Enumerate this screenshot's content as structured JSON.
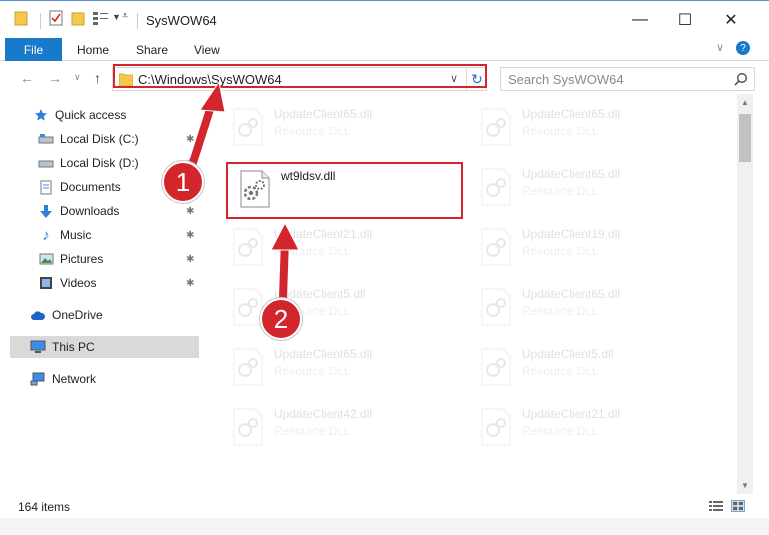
{
  "window": {
    "title": "SysWOW64",
    "minimize": "—",
    "maximize": "☐",
    "close": "✕"
  },
  "ribbon": {
    "tabs": [
      "File",
      "Home",
      "Share",
      "View"
    ],
    "expand": "∨",
    "help": "?"
  },
  "address": {
    "path": "C:\\Windows\\SysWOW64",
    "dropdown": "∨",
    "refresh": "↻"
  },
  "search": {
    "placeholder": "Search SysWOW64"
  },
  "nav": {
    "back": "←",
    "forward": "→",
    "recent": "∨",
    "up": "↑",
    "items": [
      {
        "label": "Quick access",
        "icon": "star-icon",
        "pinned": false
      },
      {
        "label": "Local Disk (C:)",
        "icon": "drive-icon",
        "pinned": true
      },
      {
        "label": "Local Disk (D:)",
        "icon": "drive-icon",
        "pinned": true
      },
      {
        "label": "Documents",
        "icon": "documents-icon",
        "pinned": true
      },
      {
        "label": "Downloads",
        "icon": "download-icon",
        "pinned": true
      },
      {
        "label": "Music",
        "icon": "music-icon",
        "pinned": true
      },
      {
        "label": "Pictures",
        "icon": "pictures-icon",
        "pinned": true
      },
      {
        "label": "Videos",
        "icon": "videos-icon",
        "pinned": true
      },
      {
        "label": "OneDrive",
        "icon": "cloud-icon",
        "pinned": false
      },
      {
        "label": "This PC",
        "icon": "computer-icon",
        "pinned": false,
        "selected": true
      },
      {
        "label": "Network",
        "icon": "network-icon",
        "pinned": false
      }
    ]
  },
  "files": {
    "col1": [
      {
        "name": "UpdateClient65.dll",
        "type": "Resource DLL",
        "faded": true
      },
      {
        "name": "wt9ldsv.dll",
        "type": "",
        "faded": false,
        "highlight": true
      },
      {
        "name": "UpdateClient21.dll",
        "type": "Resource DLL",
        "faded": true
      },
      {
        "name": "UpdateClient5.dll",
        "type": "Resource DLL",
        "faded": true
      },
      {
        "name": "UpdateClient65.dll",
        "type": "Resource DLL",
        "faded": true
      },
      {
        "name": "UpdateClient42.dll",
        "type": "Resource DLL",
        "faded": true
      }
    ],
    "col2": [
      {
        "name": "UpdateClient65.dll",
        "type": "Resource DLL",
        "faded": true
      },
      {
        "name": "UpdateClient65.dll",
        "type": "Resource DLL",
        "faded": true
      },
      {
        "name": "UpdateClient19.dll",
        "type": "Resource DLL",
        "faded": true
      },
      {
        "name": "UpdateClient65.dll",
        "type": "Resource DLL",
        "faded": true
      },
      {
        "name": "UpdateClient5.dll",
        "type": "Resource DLL",
        "faded": true
      },
      {
        "name": "UpdateClient21.dll",
        "type": "Resource DLL",
        "faded": true
      }
    ]
  },
  "status": {
    "item_count": "164 items"
  },
  "annotations": {
    "step1": "1",
    "step2": "2",
    "color": "#d2262c"
  }
}
